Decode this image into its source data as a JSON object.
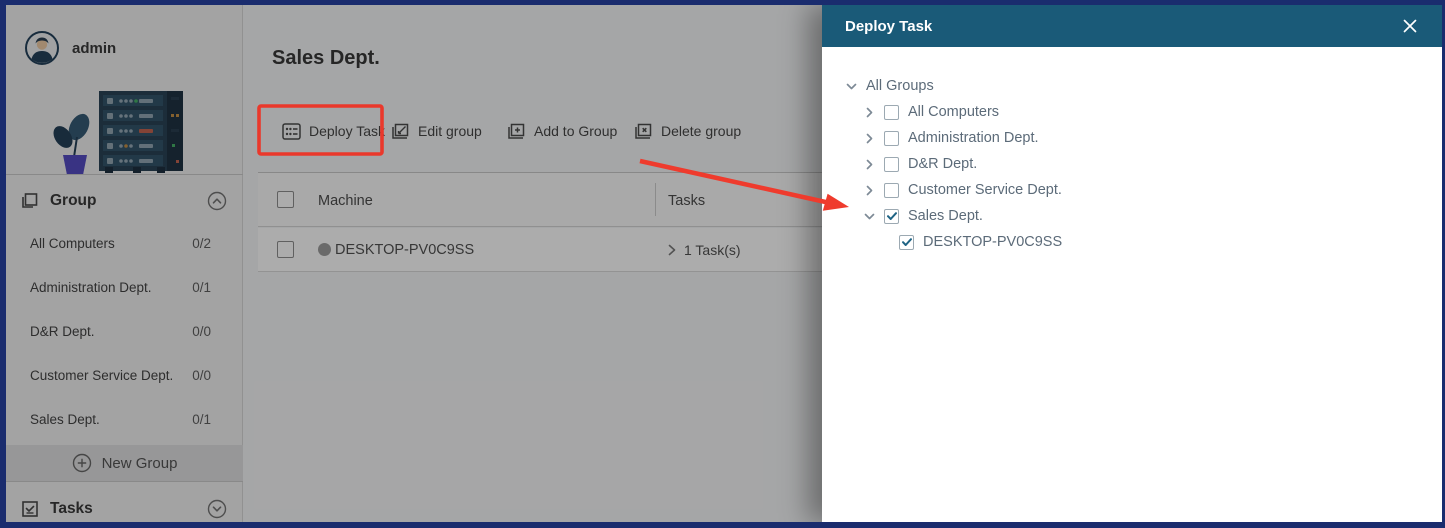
{
  "sidebar": {
    "user_name": "admin",
    "group_section": {
      "label": "Group"
    },
    "groups": [
      {
        "name": "All Computers",
        "count": "0/2"
      },
      {
        "name": "Administration Dept.",
        "count": "0/1"
      },
      {
        "name": "D&R Dept.",
        "count": "0/0"
      },
      {
        "name": "Customer Service Dept.",
        "count": "0/0"
      },
      {
        "name": "Sales Dept.",
        "count": "0/1"
      }
    ],
    "new_group_label": "New Group",
    "tasks_section": {
      "label": "Tasks"
    }
  },
  "main": {
    "title": "Sales Dept.",
    "toolbar": [
      {
        "label": "Deploy Task",
        "icon": "deploy-task-icon",
        "highlighted": true
      },
      {
        "label": "Edit group",
        "icon": "edit-group-icon"
      },
      {
        "label": "Add to Group",
        "icon": "add-to-group-icon"
      },
      {
        "label": "Delete group",
        "icon": "delete-group-icon"
      }
    ],
    "table": {
      "columns": [
        "Machine",
        "Tasks"
      ],
      "rows": [
        {
          "machine": "DESKTOP-PV0C9SS",
          "tasks": "1 Task(s)"
        }
      ]
    }
  },
  "dialog": {
    "title": "Deploy Task",
    "tree": [
      {
        "label": "All Groups",
        "level": 0,
        "expander": "down",
        "checkbox": "none"
      },
      {
        "label": "All Computers",
        "level": 1,
        "expander": "right",
        "checkbox": "unchecked"
      },
      {
        "label": "Administration Dept.",
        "level": 1,
        "expander": "right",
        "checkbox": "unchecked"
      },
      {
        "label": "D&R Dept.",
        "level": 1,
        "expander": "right",
        "checkbox": "unchecked"
      },
      {
        "label": "Customer Service Dept.",
        "level": 1,
        "expander": "right",
        "checkbox": "unchecked"
      },
      {
        "label": "Sales Dept.",
        "level": 1,
        "expander": "down",
        "checkbox": "checked"
      },
      {
        "label": "DESKTOP-PV0C9SS",
        "level": 2,
        "expander": "none",
        "checkbox": "checked"
      }
    ]
  },
  "colors": {
    "panel_header_teal": "#1A5A78",
    "annotation_red": "#EA382B",
    "check_teal": "#1F6485",
    "frame_navy": "#1A2C6E"
  }
}
